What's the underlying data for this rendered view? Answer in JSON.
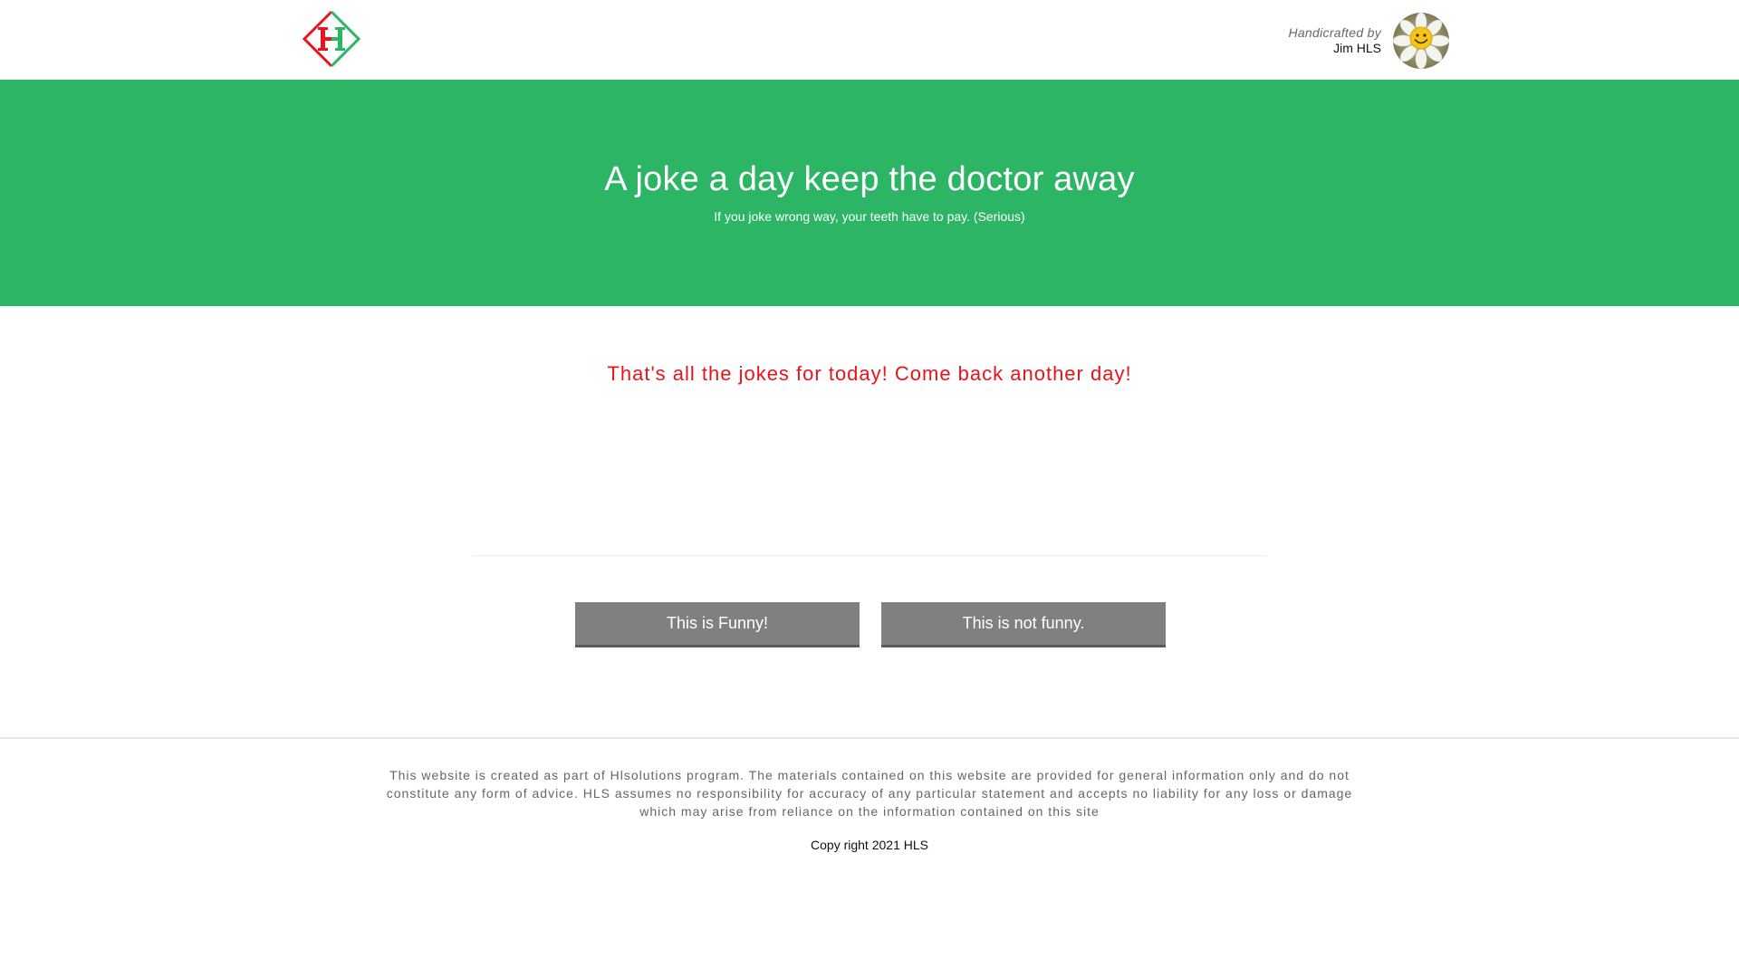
{
  "header": {
    "logo_text": "H",
    "credit_prefix": "Handicrafted by",
    "credit_author": "Jim HLS"
  },
  "hero": {
    "title": "A joke a day keep the doctor away",
    "subtitle": "If you joke wrong way, your teeth have to pay. (Serious)"
  },
  "main": {
    "message": "That's all the jokes for today! Come back another day!",
    "funny_button": "This is Funny!",
    "not_funny_button": "This is not funny."
  },
  "footer": {
    "disclaimer": "This website is created as part of Hlsolutions program. The materials contained on this website are provided for general information only and do not constitute any form of advice. HLS assumes no responsibility for accuracy of any particular statement and accepts no liability for any loss or damage which may arise from reliance on the information contained on this site",
    "copyright": "Copy right 2021 HLS"
  },
  "colors": {
    "hero_bg": "#2bb564",
    "message": "#e8141b",
    "button_bg": "#808080",
    "logo_red": "#e8141b",
    "logo_green": "#2bb564"
  },
  "icons": {
    "logo": "hls-logo-icon",
    "avatar": "smiley-daisy-avatar"
  }
}
